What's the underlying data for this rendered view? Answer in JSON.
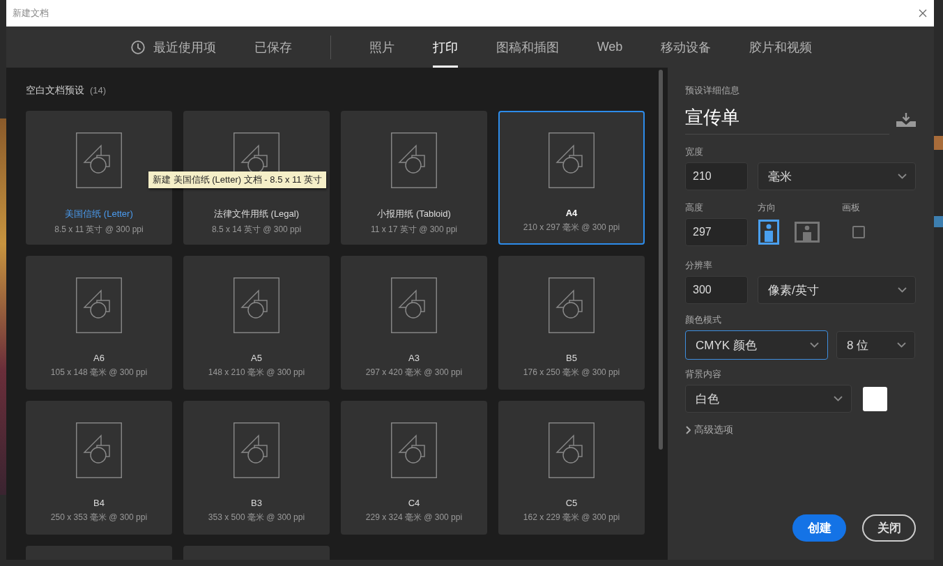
{
  "window": {
    "title": "新建文档"
  },
  "tabs": [
    {
      "kind": "history",
      "label": "最近使用项",
      "selected": false
    },
    {
      "kind": "tab",
      "label": "已保存",
      "selected": false
    },
    {
      "kind": "separator"
    },
    {
      "kind": "tab",
      "label": "照片",
      "selected": false
    },
    {
      "kind": "tab",
      "label": "打印",
      "selected": true
    },
    {
      "kind": "tab",
      "label": "图稿和插图",
      "selected": false
    },
    {
      "kind": "tab",
      "label": "Web",
      "selected": false
    },
    {
      "kind": "tab",
      "label": "移动设备",
      "selected": false
    },
    {
      "kind": "tab",
      "label": "胶片和视频",
      "selected": false
    }
  ],
  "presets": {
    "title": "空白文档预设",
    "count": "(14)",
    "items": [
      {
        "name": "美国信纸 (Letter)",
        "size": "8.5 x 11 英寸 @ 300 ppi",
        "selected": false,
        "hovered": true
      },
      {
        "name": "法律文件用纸 (Legal)",
        "size": "8.5 x 14 英寸 @ 300 ppi",
        "selected": false,
        "hovered": false
      },
      {
        "name": "小报用纸 (Tabloid)",
        "size": "11 x 17 英寸 @ 300 ppi",
        "selected": false,
        "hovered": false
      },
      {
        "name": "A4",
        "size": "210 x 297 毫米 @ 300 ppi",
        "selected": true,
        "hovered": false
      },
      {
        "name": "A6",
        "size": "105 x 148 毫米 @ 300 ppi",
        "selected": false,
        "hovered": false
      },
      {
        "name": "A5",
        "size": "148 x 210 毫米 @ 300 ppi",
        "selected": false,
        "hovered": false
      },
      {
        "name": "A3",
        "size": "297 x 420 毫米 @ 300 ppi",
        "selected": false,
        "hovered": false
      },
      {
        "name": "B5",
        "size": "176 x 250 毫米 @ 300 ppi",
        "selected": false,
        "hovered": false
      },
      {
        "name": "B4",
        "size": "250 x 353 毫米 @ 300 ppi",
        "selected": false,
        "hovered": false
      },
      {
        "name": "B3",
        "size": "353 x 500 毫米 @ 300 ppi",
        "selected": false,
        "hovered": false
      },
      {
        "name": "C4",
        "size": "229 x 324 毫米 @ 300 ppi",
        "selected": false,
        "hovered": false
      },
      {
        "name": "C5",
        "size": "162 x 229 毫米 @ 300 ppi",
        "selected": false,
        "hovered": false
      },
      {
        "selected": false
      },
      {
        "selected": false
      }
    ]
  },
  "tooltip": {
    "text": "新建 美国信纸 (Letter) 文档 - 8.5 x 11 英寸"
  },
  "details": {
    "title": "预设详细信息",
    "name": "宣传单",
    "width": {
      "label": "宽度",
      "value": "210",
      "unit": "毫米"
    },
    "height": {
      "label": "高度",
      "value": "297"
    },
    "orientation": {
      "label": "方向",
      "options": [
        {
          "kind": "portrait",
          "selected": true
        },
        {
          "kind": "landscape",
          "selected": false
        }
      ]
    },
    "artboard": {
      "label": "画板",
      "checked": false
    },
    "resolution": {
      "label": "分辨率",
      "value": "300",
      "unit": "像素/英寸"
    },
    "color_mode": {
      "label": "颜色模式",
      "mode": "CMYK 颜色",
      "focused": true,
      "depth": "8 位"
    },
    "background": {
      "label": "背景内容",
      "value": "白色",
      "color": "#ffffff"
    },
    "advanced": {
      "label": "高级选项",
      "expanded": false
    }
  },
  "buttons": [
    {
      "kind": "primary",
      "label": "创建"
    },
    {
      "kind": "secondary",
      "label": "关闭"
    }
  ]
}
